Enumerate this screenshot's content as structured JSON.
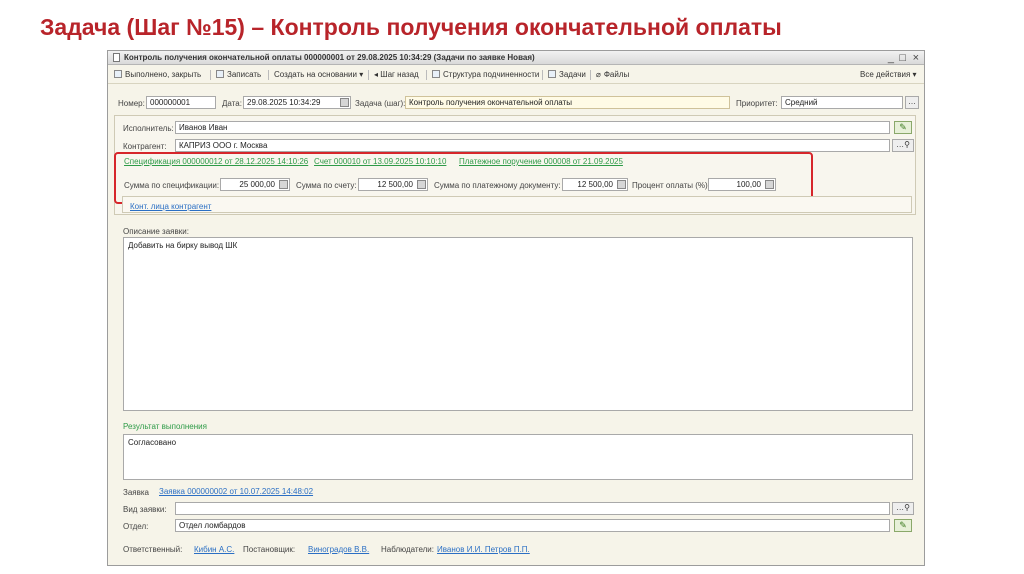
{
  "slide": {
    "title": "Задача (Шаг №15) – Контроль получения окончательной оплаты"
  },
  "window": {
    "title": "Контроль получения окончательной оплаты 000000001 от 29.08.2025 10:34:29 (Задачи по заявке Новая)",
    "controls": {
      "minimize": "_",
      "maximize": "□",
      "close": "×"
    }
  },
  "toolbar": {
    "done_close": "Выполнено, закрыть",
    "save": "Записать",
    "create_based": "Создать на основании ▾",
    "step_back": "◂ Шаг назад",
    "structure": "Структура подчиненности",
    "tasks": "Задачи",
    "files": "Файлы",
    "all_actions": "Все действия ▾"
  },
  "header": {
    "number_label": "Номер:",
    "number_value": "000000001",
    "date_label": "Дата:",
    "date_value": "29.08.2025 10:34:29",
    "task_label": "Задача (шаг):",
    "task_value": "Контроль получения окончательной оплаты",
    "priority_label": "Приоритет:",
    "priority_value": "Средний"
  },
  "fields": {
    "executor_label": "Исполнитель:",
    "executor_value": "Иванов Иван",
    "contractor_label": "Контрагент:",
    "contractor_value": "КАПРИЗ ООО г. Москва"
  },
  "links": {
    "spec": "Спецификация 000000012 от 28.12.2025 14:10:26",
    "invoice": "Счет 000010 от 13.09.2025 10:10:10",
    "payment": "Платежное поручение 000008 от 21.09.2025"
  },
  "sums": {
    "spec_label": "Сумма по спецификации:",
    "spec_value": "25 000,00",
    "invoice_label": "Сумма по счету:",
    "invoice_value": "12 500,00",
    "payment_label": "Сумма по платежному документу:",
    "payment_value": "12 500,00",
    "percent_label": "Процент оплаты (%):",
    "percent_value": "100,00"
  },
  "contacts_link": "Конт. лица контрагент",
  "description": {
    "label": "Описание заявки:",
    "text": "Добавить на бирку вывод ШК"
  },
  "result": {
    "label": "Результат выполнения",
    "text": "Согласовано"
  },
  "request": {
    "label": "Заявка",
    "link": "Заявка 000000002 от 10.07.2025 14:48:02"
  },
  "request_type": {
    "label": "Вид заявки:",
    "value": ""
  },
  "department": {
    "label": "Отдел:",
    "value": "Отдел ломбардов"
  },
  "footer": {
    "responsible_label": "Ответственный:",
    "responsible": "Кибин А.С.",
    "assigner_label": "Постановщик:",
    "assigner": "Виноградов В.В.",
    "observers_label": "Наблюдатели:",
    "observers": "Иванов И.И. Петров П.П."
  },
  "colors": {
    "title_red": "#b8242a",
    "highlight_red": "#d6262b",
    "link_blue": "#2b6fc4",
    "link_green": "#2e9b48"
  }
}
